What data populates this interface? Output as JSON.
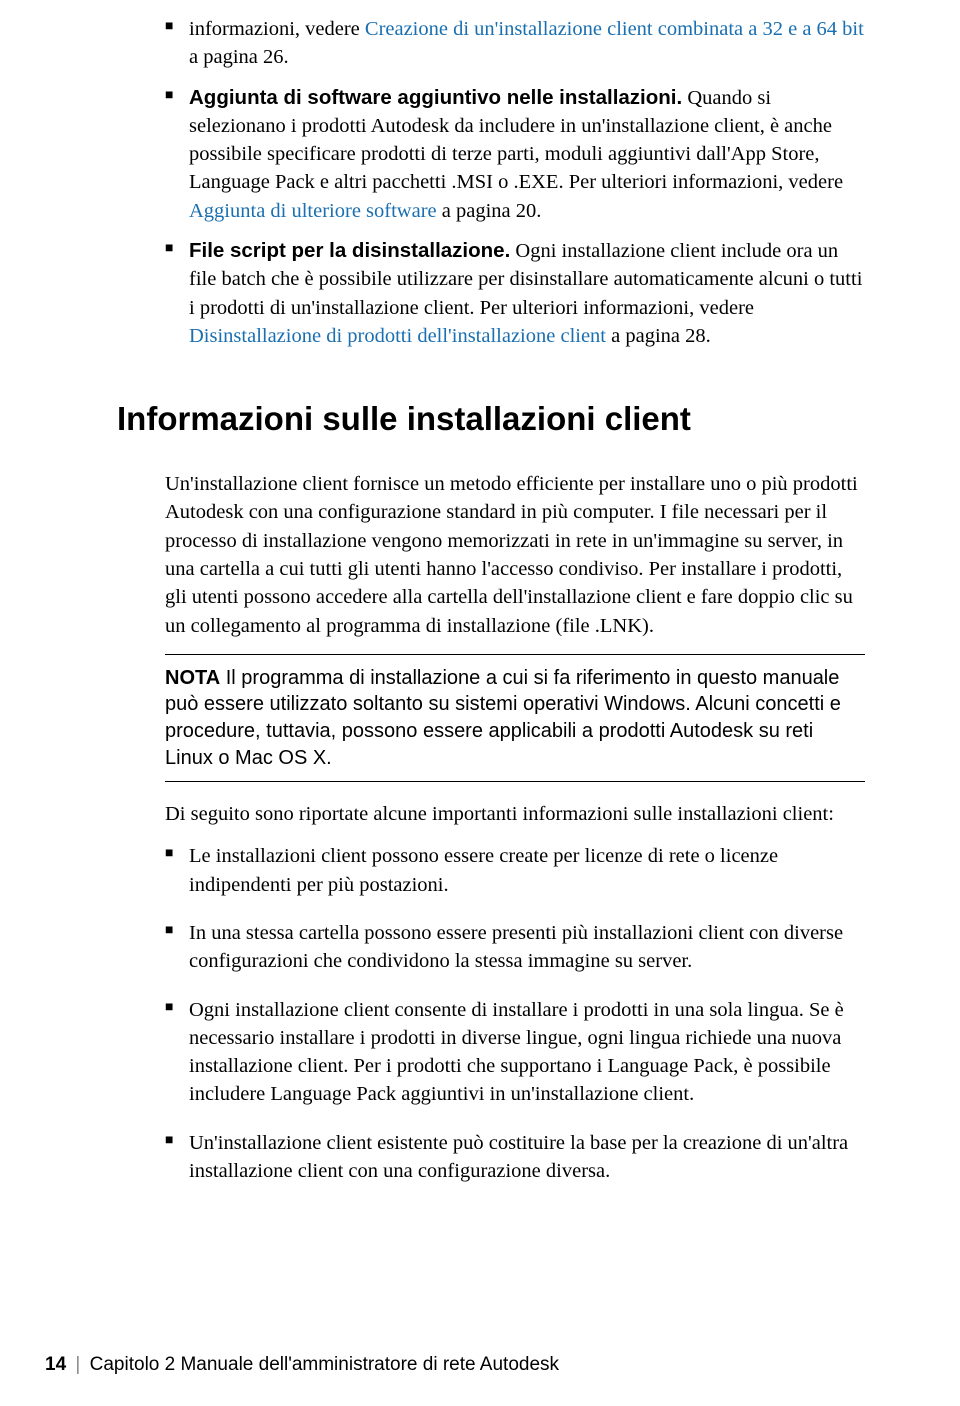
{
  "bullets_top": [
    {
      "pre": "informazioni, vedere ",
      "link": "Creazione di un'installazione client combinata a 32 e a 64 bit",
      "post": " a pagina 26."
    },
    {
      "bold": "Aggiunta di software aggiuntivo nelle installazioni.",
      "text": " Quando si selezionano i prodotti Autodesk da includere in un'installazione client, è anche possibile specificare prodotti di terze parti, moduli aggiuntivi dall'App Store, Language Pack e altri pacchetti .MSI o .EXE. Per ulteriori informazioni, vedere ",
      "link": "Aggiunta di ulteriore software",
      "post": " a pagina 20."
    },
    {
      "bold": "File script per la disinstallazione.",
      "text": " Ogni installazione client include ora un file batch che è possibile utilizzare per disinstallare automaticamente alcuni o tutti i prodotti di un'installazione client. Per ulteriori informazioni, vedere ",
      "link": "Disinstallazione di prodotti dell'installazione client",
      "post": " a pagina 28."
    }
  ],
  "heading": "Informazioni sulle installazioni client",
  "para1": "Un'installazione client fornisce un metodo efficiente per installare uno o più prodotti Autodesk con una configurazione standard in più computer. I file necessari per il processo di installazione vengono memorizzati in rete in un'immagine su server, in una cartella a cui tutti gli utenti hanno l'accesso condiviso. Per installare i prodotti, gli utenti possono accedere alla cartella dell'installazione client e fare doppio clic su un collegamento al programma di installazione (file .LNK).",
  "note_label": "NOTA",
  "note_text": " Il programma di installazione a cui si fa riferimento in questo manuale può essere utilizzato soltanto su sistemi operativi Windows. Alcuni concetti e procedure, tuttavia, possono essere applicabili a prodotti Autodesk su reti Linux o Mac OS X.",
  "para2": "Di seguito sono riportate alcune importanti informazioni sulle installazioni client:",
  "bullets_bottom": [
    "Le installazioni client possono essere create per licenze di rete o licenze indipendenti per più postazioni.",
    "In una stessa cartella possono essere presenti più installazioni client con diverse configurazioni che condividono la stessa immagine su server.",
    "Ogni installazione client consente di installare i prodotti in una sola lingua. Se è necessario installare i prodotti in diverse lingue, ogni lingua richiede una nuova installazione client. Per i prodotti che supportano i Language Pack, è possibile includere Language Pack aggiuntivi in un'installazione client.",
    "Un'installazione client esistente può costituire la base per la creazione di un'altra installazione client con una configurazione diversa."
  ],
  "footer": {
    "page": "14",
    "chapter": "Capitolo 2   Manuale dell'amministratore di rete Autodesk"
  }
}
